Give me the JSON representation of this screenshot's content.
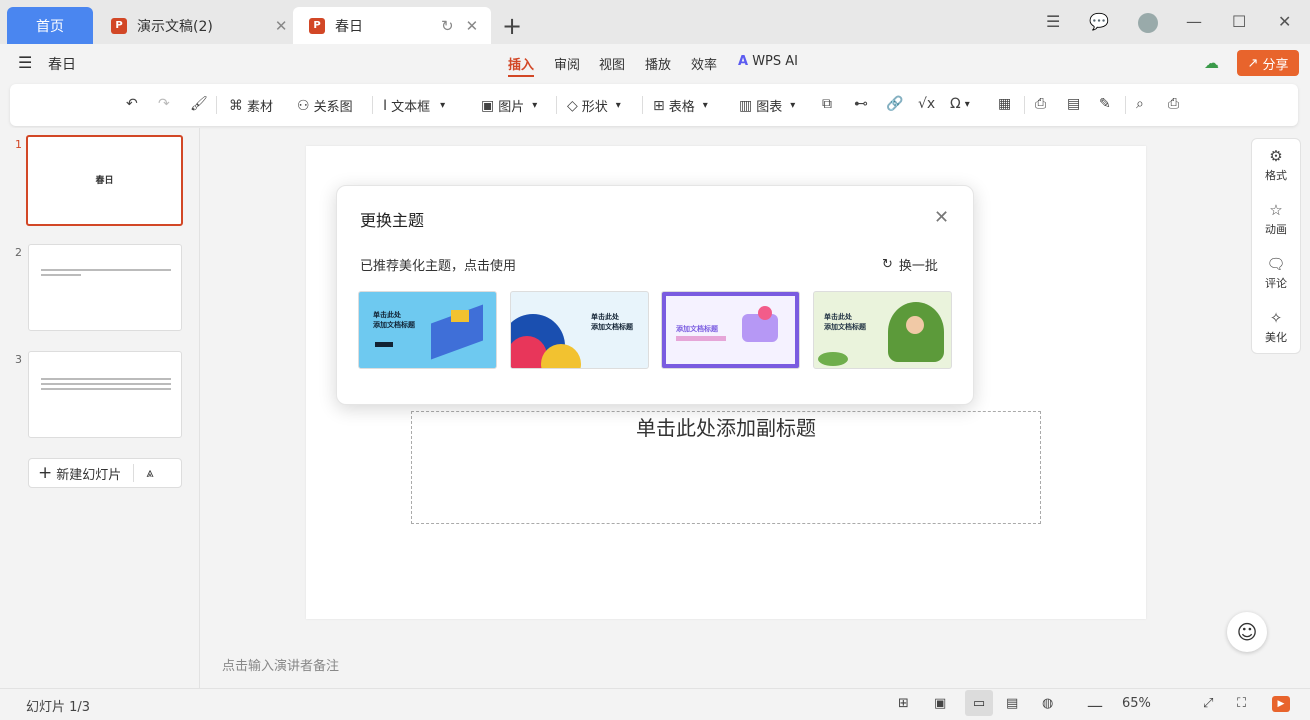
{
  "tabs": {
    "home": "首页",
    "doc1": "演示文稿(2)",
    "doc2": "春日"
  },
  "title_row": {
    "doc_name": "春日",
    "menu": [
      "插入",
      "审阅",
      "视图",
      "播放",
      "效率",
      "WPS AI"
    ],
    "active_menu": "插入",
    "share": "分享"
  },
  "toolbar": {
    "material": "素材",
    "relation": "关系图",
    "textbox": "文本框",
    "picture": "图片",
    "shape": "形状",
    "table": "表格",
    "chart": "图表"
  },
  "slides": {
    "items": [
      {
        "num": "1",
        "title": "春日"
      },
      {
        "num": "2"
      },
      {
        "num": "3"
      }
    ],
    "new_slide": "新建幻灯片"
  },
  "canvas": {
    "subtitle_placeholder": "单击此处添加副标题"
  },
  "dialog": {
    "title": "更换主题",
    "recommend": "已推荐美化主题，点击使用",
    "swap": "换一批",
    "themes": [
      {
        "line1": "单击此处",
        "line2": "添加文档标题"
      },
      {
        "line1": "单击此处",
        "line2": "添加文档标题"
      },
      {
        "line1": "添加文档标题",
        "line2": ""
      },
      {
        "line1": "单击此处",
        "line2": "添加文档标题"
      }
    ]
  },
  "right_panel": [
    "格式",
    "动画",
    "评论",
    "美化"
  ],
  "notes": "点击输入演讲者备注",
  "status": {
    "slide_count": "幻灯片 1/3",
    "zoom": "65%"
  },
  "colors": {
    "accent": "#d24726",
    "home_tab": "#4a86f0",
    "share": "#e8642c"
  }
}
